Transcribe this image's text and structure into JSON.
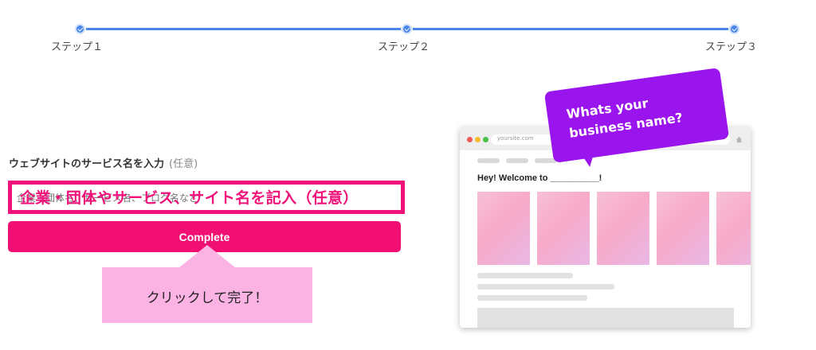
{
  "stepper": {
    "steps": [
      {
        "label": "ステップ１"
      },
      {
        "label": "ステップ２"
      },
      {
        "label": "ステップ３"
      }
    ],
    "accent_color": "#4a86e8"
  },
  "form": {
    "field_label": "ウェブサイトのサービス名を入力",
    "field_optional": "(任意)",
    "input_placeholder": "企業・団体名、サービス名、ブログ名など",
    "input_overlay_text": "企業・団体やサービス、サイト名を記入（任意）",
    "complete_button": "Complete",
    "accent_color": "#f20f74"
  },
  "callout": {
    "text": "クリックして完了！",
    "color": "#fbb3e4"
  },
  "preview": {
    "url": "yoursite.com",
    "welcome_text": "Hey! Welcome to __________!",
    "bubble_text": "Whats your business name?",
    "bubble_color": "#9a14ee",
    "home_icon": "home-icon"
  }
}
